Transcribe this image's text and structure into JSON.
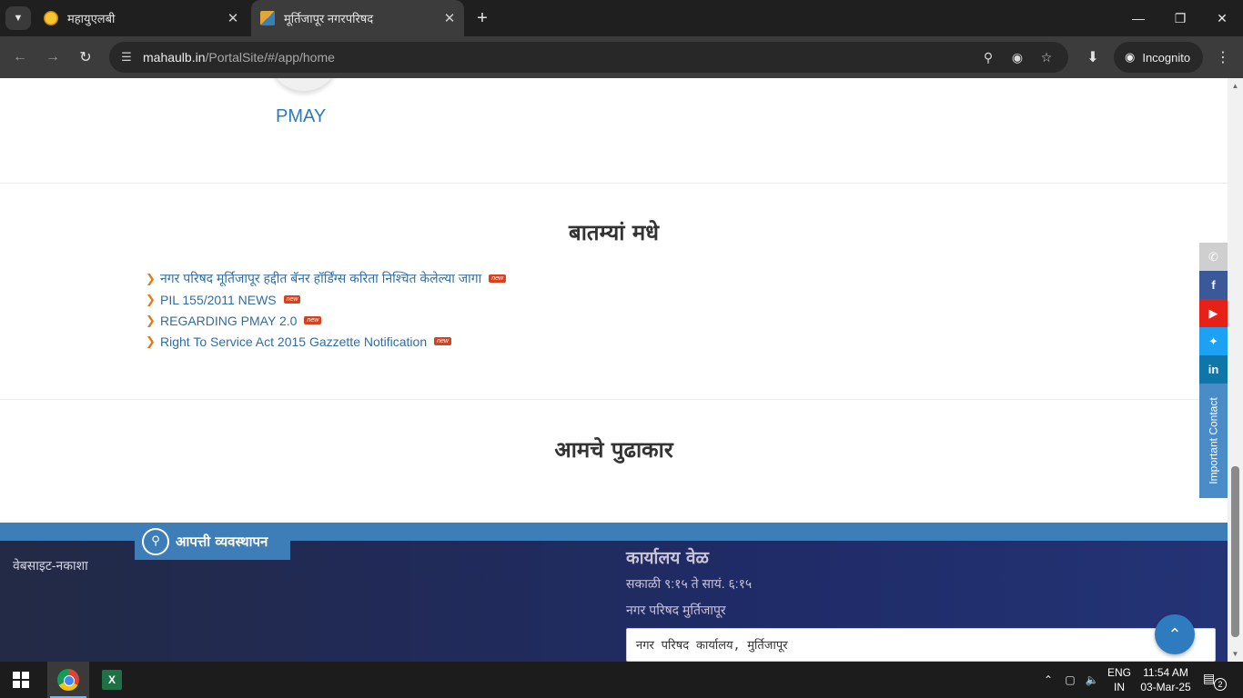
{
  "browser": {
    "tabs": [
      {
        "title": "महायुएलबी",
        "active": false
      },
      {
        "title": "मूर्तिजापूर नगरपरिषद",
        "active": true
      }
    ],
    "url_host": "mahaulb.in",
    "url_path": "/PortalSite/#/app/home",
    "incognito_label": "Incognito"
  },
  "page": {
    "pmay_label": "PMAY",
    "news": {
      "heading": "बातम्यां मधे",
      "badge": "new",
      "items": [
        "नगर परिषद मूर्तिजापूर हद्दीत बॅनर हॉर्डिंग्स करिता निश्चित केलेल्या जागा",
        "PIL 155/2011 NEWS",
        "REGARDING PMAY 2.0",
        "Right To Service Act 2015 Gazzette Notification"
      ]
    },
    "leaders_heading": "आमचे पुढाकार",
    "social": {
      "items": [
        "phone-icon",
        "facebook-icon",
        "youtube-icon",
        "twitter-icon",
        "linkedin-icon"
      ],
      "important_contact": "Important Contact"
    },
    "footer": {
      "disaster_mgmt": "आपत्ती व्यवस्थापन",
      "sitemap": "वेबसाइट-नकाशा",
      "office_title": "कार्यालय वेळ",
      "office_hours": "सकाळी ९:१५ ते सायं. ६:१५",
      "office_name": "नगर परिषद मुर्तिजापूर",
      "address": "नगर परिषद कार्यालय, मुर्तिजापूर"
    }
  },
  "taskbar": {
    "lang_top": "ENG",
    "lang_bottom": "IN",
    "time": "11:54 AM",
    "date": "03-Mar-25",
    "notification_count": "2"
  }
}
